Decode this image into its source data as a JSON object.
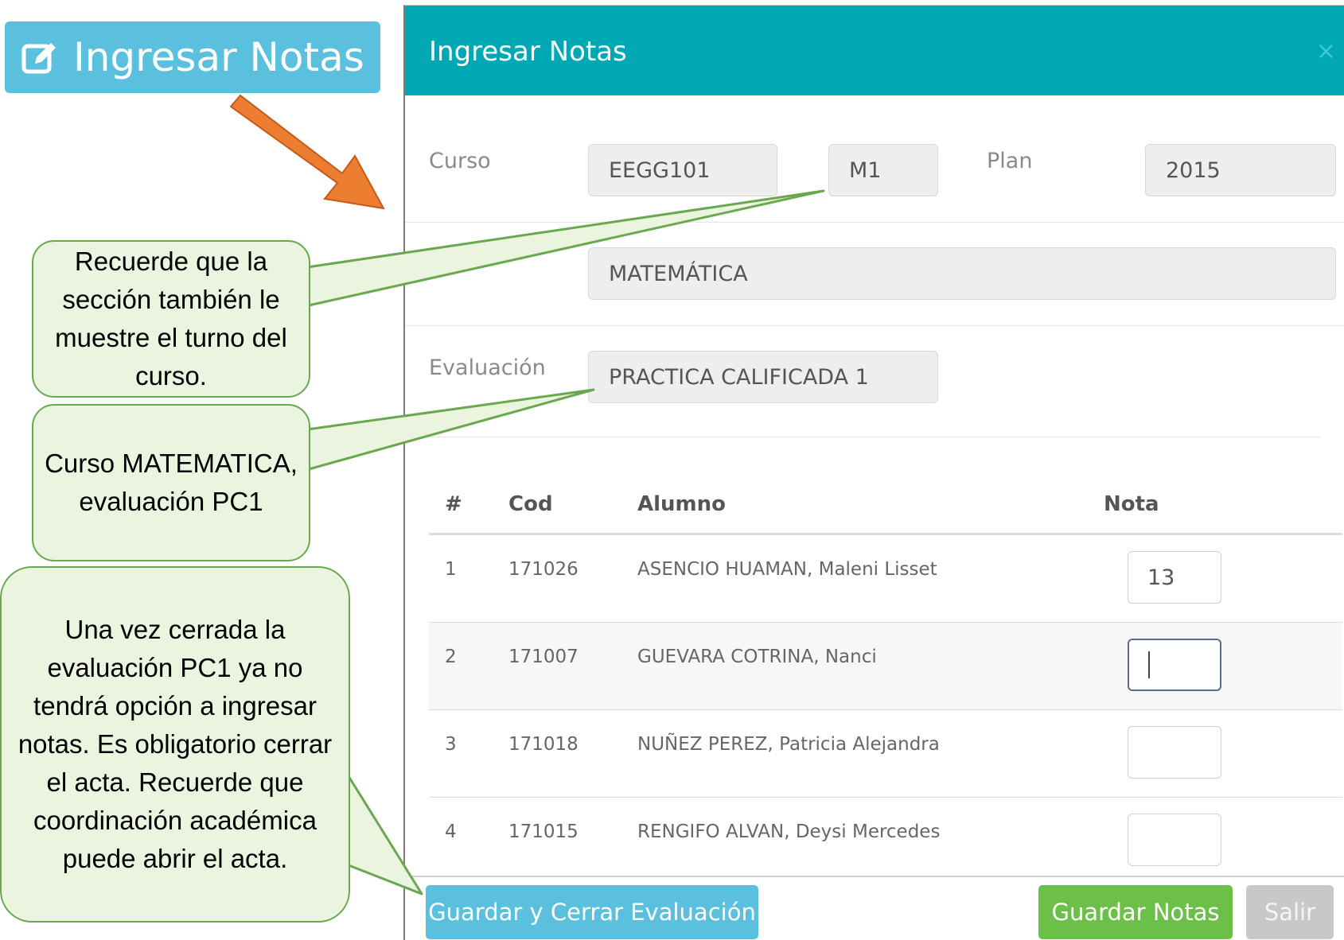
{
  "trigger": {
    "label": "Ingresar Notas",
    "icon": "edit-icon"
  },
  "modal": {
    "title": "Ingresar Notas",
    "close": "×",
    "curso_label": "Curso",
    "curso_code": "EEGG101",
    "seccion": "M1",
    "plan_label": "Plan",
    "plan": "2015",
    "curso_nombre": "MATEMÁTICA",
    "evaluacion_label": "Evaluación",
    "evaluacion": "PRACTICA CALIFICADA 1",
    "table": {
      "headers": [
        "#",
        "Cod",
        "Alumno",
        "Nota"
      ],
      "rows": [
        {
          "n": "1",
          "cod": "171026",
          "alumno": "ASENCIO HUAMAN, Maleni Lisset",
          "nota": "13"
        },
        {
          "n": "2",
          "cod": "171007",
          "alumno": "GUEVARA COTRINA, Nanci",
          "nota": ""
        },
        {
          "n": "3",
          "cod": "171018",
          "alumno": "NUÑEZ PEREZ, Patricia Alejandra",
          "nota": ""
        },
        {
          "n": "4",
          "cod": "171015",
          "alumno": "RENGIFO ALVAN, Deysi Mercedes",
          "nota": ""
        }
      ]
    },
    "buttons": {
      "close_eval": "Guardar y Cerrar Evaluación",
      "save": "Guardar Notas",
      "exit": "Salir"
    }
  },
  "callouts": {
    "seccion": "Recuerde que la sección también le muestre el turno del curso.",
    "curso": "Curso MATEMATICA, evaluación PC1",
    "cerrar": "Una vez cerrada la evaluación PC1 ya no tendrá opción a ingresar notas. Es obligatorio cerrar el acta. Recuerde que coordinación académica puede abrir el acta."
  },
  "colors": {
    "header": "#00a8b4",
    "info_button": "#5bc0de",
    "success_button": "#6cc04a",
    "arrow": "#ed7d31",
    "callout_border": "#6aa84f",
    "callout_fill": "#ebf4df"
  }
}
